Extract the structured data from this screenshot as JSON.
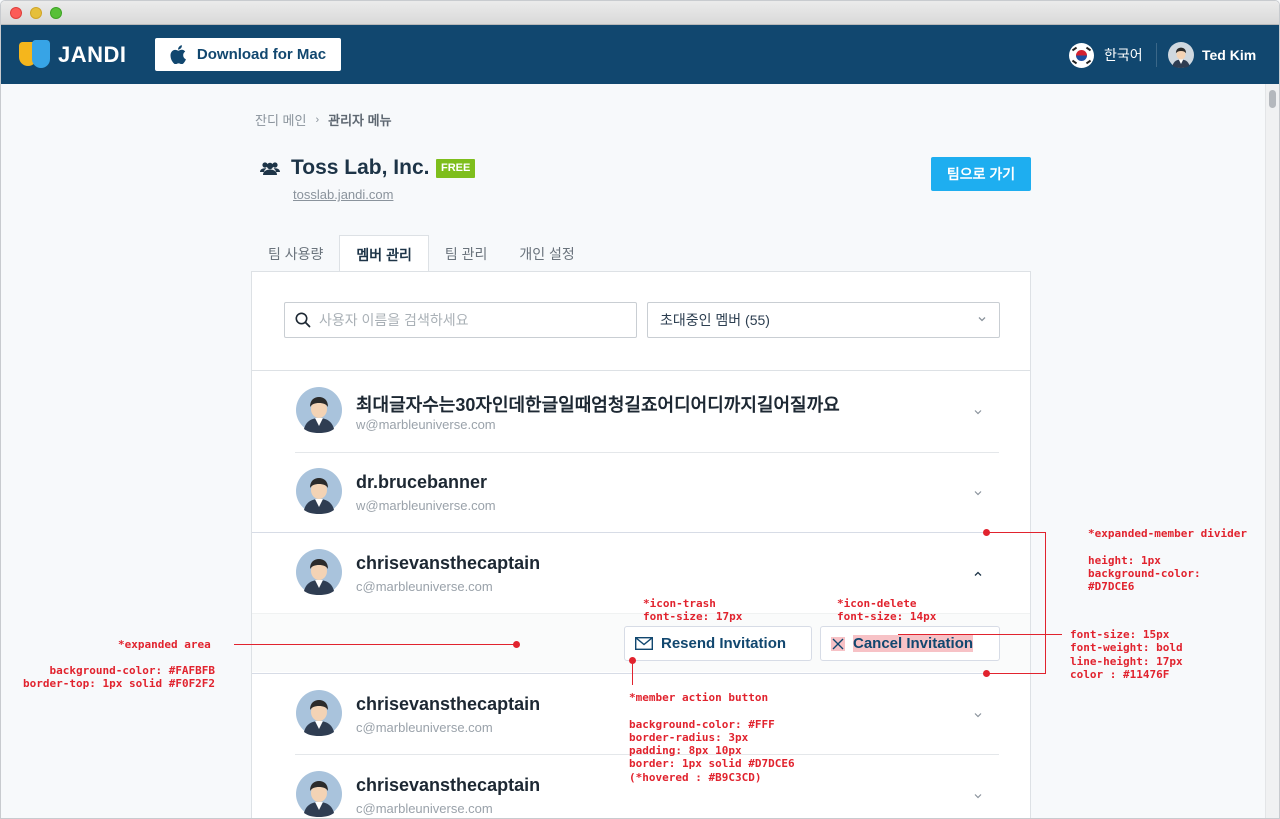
{
  "app": {
    "logo_text": "JANDI",
    "download_label": "Download for Mac",
    "language": "한국어",
    "user_name": "Ted Kim"
  },
  "breadcrumb": {
    "home": "잔디 메인",
    "current": "관리자 메뉴"
  },
  "team": {
    "name": "Toss Lab, Inc.",
    "plan_badge": "FREE",
    "url": "tosslab.jandi.com",
    "goto_label": "팀으로 가기"
  },
  "tabs": [
    {
      "label": "팀 사용량",
      "active": false
    },
    {
      "label": "멤버 관리",
      "active": true
    },
    {
      "label": "팀 관리",
      "active": false
    },
    {
      "label": "개인 설정",
      "active": false
    }
  ],
  "filters": {
    "search_placeholder": "사용자 이름을 검색하세요",
    "member_filter": "초대중인 멤버 (55)"
  },
  "members": [
    {
      "name": "최대글자수는30자인데한글일때엄청길죠어디어디까지길어질까요",
      "email": "w@marbleuniverse.com",
      "expanded": false
    },
    {
      "name": "dr.brucebanner",
      "email": "w@marbleuniverse.com",
      "expanded": false
    },
    {
      "name": "chrisevansthecaptain",
      "email": "c@marbleuniverse.com",
      "expanded": true
    },
    {
      "name": "chrisevansthecaptain",
      "email": "c@marbleuniverse.com",
      "expanded": false
    },
    {
      "name": "chrisevansthecaptain",
      "email": "c@marbleuniverse.com",
      "expanded": false
    }
  ],
  "actions": {
    "resend": "Resend Invitation",
    "cancel": "Cancel Invitation"
  },
  "annotations": {
    "divider": "*expanded-member divider\n\nheight: 1px\nbackground-color:\n#D7DCE6",
    "icon_trash": "*icon-trash\nfont-size: 17px",
    "icon_delete": "*icon-delete\nfont-size: 14px",
    "expanded_area_title": "*expanded area",
    "expanded_area_spec": "background-color: #FAFBFB\nborder-top: 1px solid #F0F2F2",
    "button_font": "font-size: 15px\nfont-weight: bold\nline-height: 17px\ncolor : #11476F",
    "member_action_button": "*member action button\n\nbackground-color: #FFF\nborder-radius: 3px\npadding: 8px 10px\nborder: 1px solid #D7DCE6\n(*hovered : #B9C3CD)"
  },
  "colors": {
    "topbar": "#11476F",
    "accent": "#1EAEF0",
    "free_badge": "#7EBE1C",
    "annotation": "#E1232E"
  }
}
